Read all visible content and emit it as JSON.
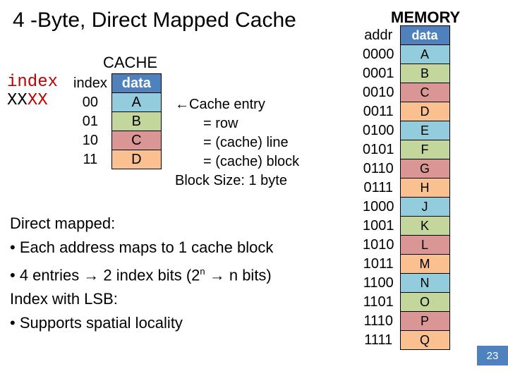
{
  "title": "4 -Byte, Direct Mapped Cache",
  "memory_label": "MEMORY",
  "cache_label": "CACHE",
  "mem_hdr": {
    "addr": "addr",
    "data": "data"
  },
  "memory": [
    {
      "addr": "0000",
      "data": "A",
      "c": 0
    },
    {
      "addr": "0001",
      "data": "B",
      "c": 1
    },
    {
      "addr": "0010",
      "data": "C",
      "c": 2
    },
    {
      "addr": "0011",
      "data": "D",
      "c": 3
    },
    {
      "addr": "0100",
      "data": "E",
      "c": 0
    },
    {
      "addr": "0101",
      "data": "F",
      "c": 1
    },
    {
      "addr": "0110",
      "data": "G",
      "c": 2
    },
    {
      "addr": "0111",
      "data": "H",
      "c": 3
    },
    {
      "addr": "1000",
      "data": "J",
      "c": 0
    },
    {
      "addr": "1001",
      "data": "K",
      "c": 1
    },
    {
      "addr": "1010",
      "data": "L",
      "c": 2
    },
    {
      "addr": "1011",
      "data": "M",
      "c": 3
    },
    {
      "addr": "1100",
      "data": "N",
      "c": 0
    },
    {
      "addr": "1101",
      "data": "O",
      "c": 1
    },
    {
      "addr": "1110",
      "data": "P",
      "c": 2
    },
    {
      "addr": "1111",
      "data": "Q",
      "c": 3
    }
  ],
  "cache_hdr": {
    "idx": "index",
    "data": "data"
  },
  "cache": [
    {
      "idx": "00",
      "data": "A",
      "c": 0
    },
    {
      "idx": "01",
      "data": "B",
      "c": 1
    },
    {
      "idx": "10",
      "data": "C",
      "c": 2
    },
    {
      "idx": "11",
      "data": "D",
      "c": 3
    }
  ],
  "index_label": {
    "line1": "index",
    "bits_prefix": "XX",
    "bits_suffix": "XX"
  },
  "notes": {
    "l1": "←Cache entry",
    "l2": "= row",
    "l3": "= (cache) line",
    "l4": "= (cache) block",
    "l5": "Block Size: 1 byte"
  },
  "body": {
    "h1": "Direct mapped:",
    "b1": "•  Each address maps to 1 cache block",
    "b2_pre": "•  4 entries → 2 index bits (2",
    "b2_sup": "n",
    "b2_post": " → n bits)",
    "h2": "Index with LSB:",
    "b3": "•  Supports spatial locality"
  },
  "page_number": "23"
}
